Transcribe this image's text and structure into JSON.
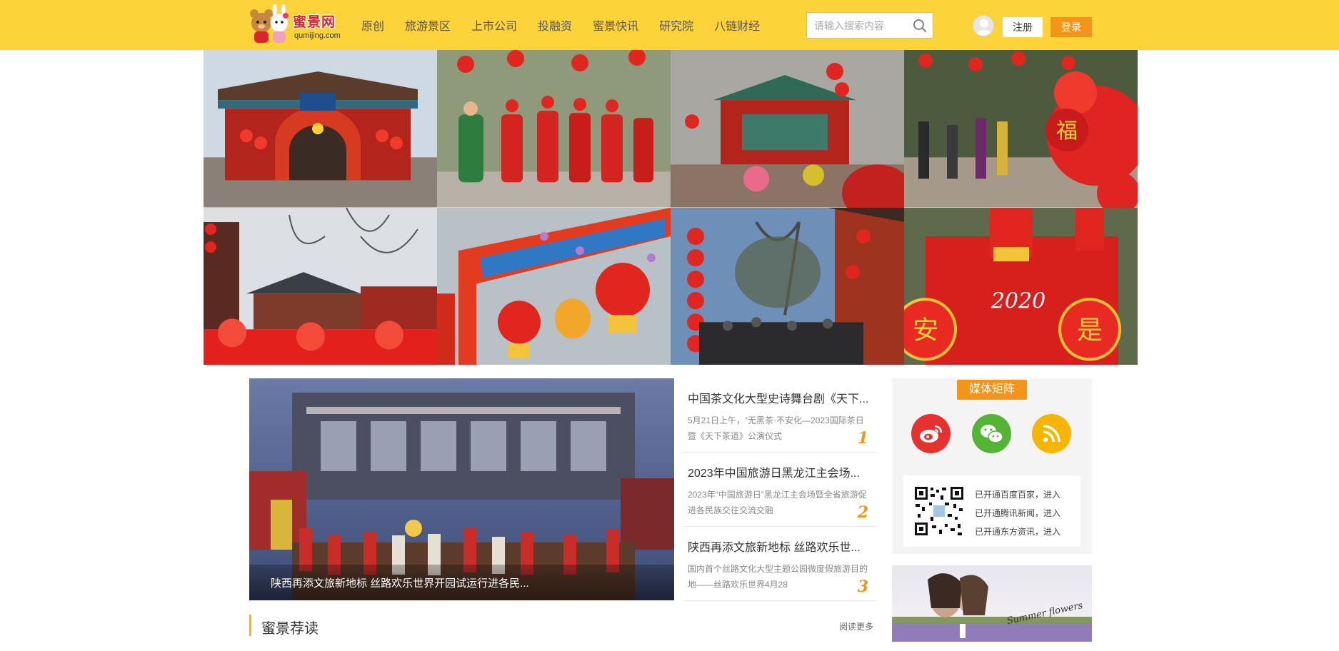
{
  "header": {
    "logo_text": "蜜景网",
    "logo_sub": "qumijing.com",
    "nav": [
      "原创",
      "旅游景区",
      "上市公司",
      "投融资",
      "蜜景快讯",
      "研究院",
      "八链财经"
    ],
    "search_placeholder": "请输入搜索内容",
    "register": "注册",
    "login": "登录"
  },
  "gallery": [
    {
      "theme": "temple-gate",
      "label": ""
    },
    {
      "theme": "performers",
      "label": ""
    },
    {
      "theme": "pavilion",
      "label": ""
    },
    {
      "theme": "fu-flowers",
      "label": "福"
    },
    {
      "theme": "winter-temple",
      "label": ""
    },
    {
      "theme": "arch-lanterns",
      "label": ""
    },
    {
      "theme": "crowd-lanterns",
      "label": ""
    },
    {
      "theme": "2020-door",
      "label": "2020",
      "left_char": "安",
      "right_char": "是"
    }
  ],
  "feature": {
    "caption": "陕西再添文旅新地标 丝路欢乐世界开园试运行进各民..."
  },
  "news": [
    {
      "title": "中国茶文化大型史诗舞台剧《天下...",
      "desc": "5月21日上午，“无黑茶·不安化—2023国际茶日暨《天下茶道》公演仪式",
      "num": "1"
    },
    {
      "title": "2023年中国旅游日黑龙江主会场...",
      "desc": "2023年“中国旅游日”黑龙江主会场暨全省旅游促进各民族交往交流交融",
      "num": "2"
    },
    {
      "title": "陕西再添文旅新地标 丝路欢乐世...",
      "desc": "国内首个丝路文化大型主题公园微度假旅游目的地——丝路欢乐世界4月28",
      "num": "3"
    }
  ],
  "section": {
    "title": "蜜景荐读",
    "more": "阅读更多"
  },
  "sidebar": {
    "media_title": "媒体矩阵",
    "social": [
      {
        "name": "weibo-icon",
        "color": "#e6312e"
      },
      {
        "name": "wechat-icon",
        "color": "#54b534"
      },
      {
        "name": "rss-icon",
        "color": "#f7b500"
      }
    ],
    "qr_lines": [
      "已开通百度百家，进入",
      "已开通腾讯新闻，进入",
      "已开通东方资讯，进入"
    ],
    "ad_text": "Summer flowers"
  },
  "colors": {
    "header_bg": "#fdd33a",
    "accent": "#f39519",
    "lantern_red": "#e0261e"
  }
}
